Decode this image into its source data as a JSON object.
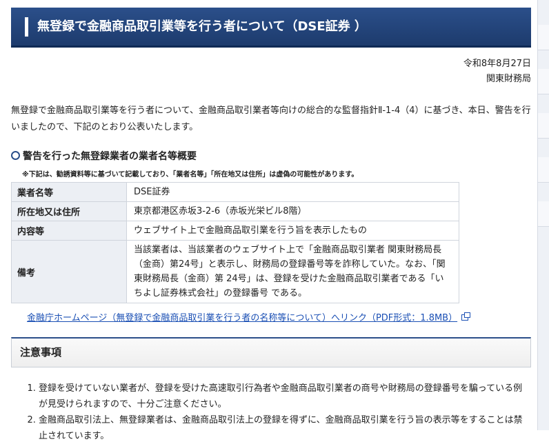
{
  "header": {
    "title": "無登録で金融商品取引業等を行う者について（DSE証券 ）"
  },
  "date": {
    "date": "令和8年8月27日",
    "issuer": "関東財務局"
  },
  "intro": "無登録で金融商品取引業等を行う者について、金融商品取引業者等向けの総合的な監督指針Ⅱ-1-4（4）に基づき、本日、警告を行いましたので、下記のとおり公表いたします。",
  "section": {
    "title": "警告を行った無登録業者の業者名等概要",
    "note": "※下記は、勧誘資料等に基づいて記載しており、「業者名等」「所在地又は住所」は虚偽の可能性があります。"
  },
  "table": {
    "rows": [
      {
        "label": "業者名等",
        "value": "DSE証券"
      },
      {
        "label": "所在地又は住所",
        "value": "東京都港区赤坂3-2-6（赤坂光栄ビル8階）"
      },
      {
        "label": "内容等",
        "value": "ウェブサイト上で金融商品取引業を行う旨を表示したもの"
      },
      {
        "label": "備考",
        "value": "当該業者は、当該業者のウェブサイト上で「金融商品取引業者 関東財務局長（金商）第24号」と表示し、財務局の登録番号等を詐称していた。なお、「関東財務局長（金商）第 24号」は、登録を受けた金融商品取引業者である「いちよし証券株式会社」の登録番号 である。"
      }
    ]
  },
  "link": {
    "text": "金融庁ホームページ（無登録で金融商品取引業を行う者の名称等について）へリンク（PDF形式：1.8MB）",
    "icon": "external-link-icon"
  },
  "caution": {
    "title": "注意事項",
    "items": [
      "登録を受けていない業者が、登録を受けた高速取引行為者や金融商品取引業者の商号や財務局の登録番号を騙っている例が見受けられますので、十分ご注意ください。",
      "金融商品取引法上、無登録業者は、金融商品取引法上の登録を得ずに、金融商品取引業を行う旨の表示等をすることは禁止されています。"
    ]
  }
}
